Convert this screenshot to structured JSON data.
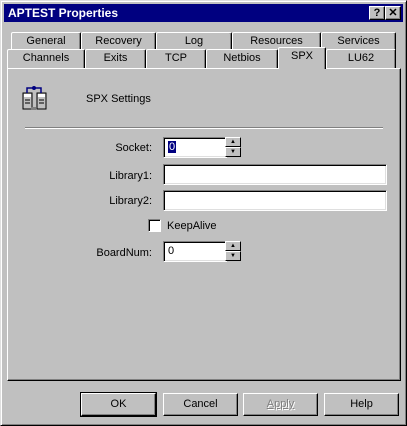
{
  "window": {
    "title": "APTEST Properties",
    "help_glyph": "?",
    "close_glyph": "✕"
  },
  "tabs_back_row": [
    "General",
    "Recovery",
    "Log",
    "Resources",
    "Services"
  ],
  "tabs_front_row": [
    "Channels",
    "Exits",
    "TCP",
    "Netbios",
    "SPX",
    "LU62"
  ],
  "active_tab": "SPX",
  "section": {
    "title": "SPX Settings",
    "icon": "network-computers-icon"
  },
  "fields": {
    "socket": {
      "label": "Socket:",
      "value": "0"
    },
    "library1": {
      "label": "Library1:",
      "value": ""
    },
    "library2": {
      "label": "Library2:",
      "value": ""
    },
    "keepalive": {
      "label": "KeepAlive",
      "checked": false
    },
    "boardnum": {
      "label": "BoardNum:",
      "value": "0"
    }
  },
  "buttons": {
    "ok": "OK",
    "cancel": "Cancel",
    "apply": "Apply",
    "help": "Help"
  }
}
